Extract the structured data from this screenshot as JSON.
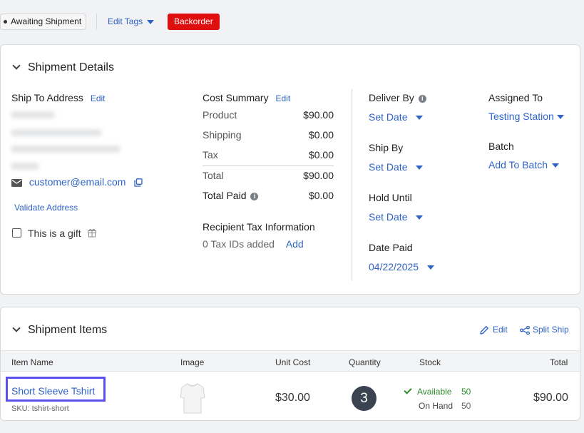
{
  "topbar": {
    "status": "Awaiting Shipment",
    "edit_tags": "Edit Tags",
    "tag": "Backorder"
  },
  "details": {
    "title": "Shipment Details",
    "ship_to": {
      "label": "Ship To Address",
      "edit": "Edit",
      "email": "customer@email.com",
      "validate": "Validate Address",
      "gift_label": "This is a gift"
    },
    "cost": {
      "label": "Cost Summary",
      "edit": "Edit",
      "rows": [
        {
          "name": "Product",
          "value": "$90.00"
        },
        {
          "name": "Shipping",
          "value": "$0.00"
        },
        {
          "name": "Tax",
          "value": "$0.00"
        },
        {
          "name": "Total",
          "value": "$90.00"
        },
        {
          "name": "Total Paid",
          "value": "$0.00"
        }
      ],
      "tax_info_label": "Recipient Tax Information",
      "tax_ids": "0 Tax IDs added",
      "tax_add": "Add"
    },
    "deliver_by": {
      "label": "Deliver By",
      "value": "Set Date"
    },
    "ship_by": {
      "label": "Ship By",
      "value": "Set Date"
    },
    "hold_until": {
      "label": "Hold Until",
      "value": "Set Date"
    },
    "date_paid": {
      "label": "Date Paid",
      "value": "04/22/2025"
    },
    "assigned_to": {
      "label": "Assigned To",
      "value": "Testing Station"
    },
    "batch": {
      "label": "Batch",
      "value": "Add To Batch"
    }
  },
  "items": {
    "title": "Shipment Items",
    "edit": "Edit",
    "split": "Split Ship",
    "columns": [
      "Item Name",
      "Image",
      "Unit Cost",
      "Quantity",
      "Stock",
      "Total"
    ],
    "rows": [
      {
        "name": "Short Sleeve Tshirt",
        "sku": "SKU: tshirt-short",
        "unit_cost": "$30.00",
        "quantity": "3",
        "available_label": "Available",
        "available": "50",
        "onhand_label": "On Hand",
        "onhand": "50",
        "total": "$90.00"
      }
    ]
  },
  "colors": {
    "accent": "#2f63c8",
    "backorder": "#e00f0f",
    "highlight": "#5b4ff0",
    "available": "#2e8b2e"
  }
}
